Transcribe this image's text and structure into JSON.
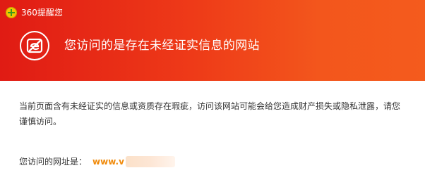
{
  "window": {
    "title": "360提醒您",
    "accent_color": "#e01b14",
    "icon": "360-logo-icon"
  },
  "header": {
    "icon": "edge-browser-warning-icon",
    "headline": "您访问的是存在未经证实信息的网站"
  },
  "body": {
    "description": "当前页面含有未经证实的信息或资质存在瑕疵，访问该网站可能会给您造成财产损失或隐私泄露，请您谨慎访问。",
    "url_label": "您访问的网址是：",
    "url_value": "www.v",
    "url_color": "#f08a0a"
  }
}
